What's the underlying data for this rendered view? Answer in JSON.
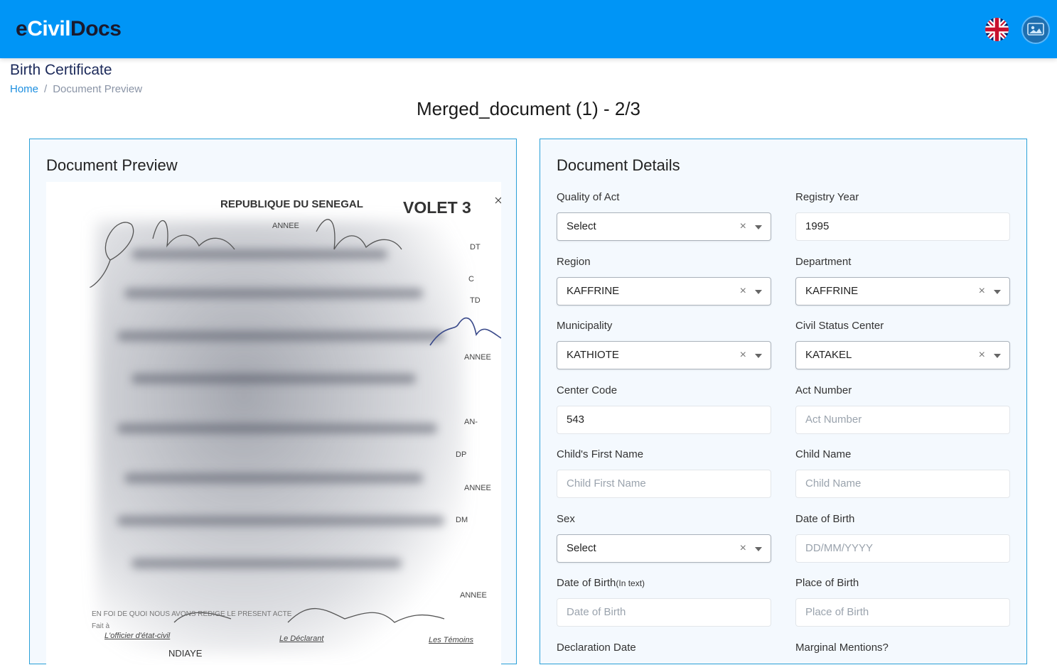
{
  "header": {
    "logo_part1": "e",
    "logo_part2": "Civil",
    "logo_part3": "Docs",
    "language_icon": "uk-flag-icon",
    "avatar_icon": "user-avatar-icon"
  },
  "page": {
    "title": "Birth Certificate",
    "breadcrumb": {
      "home": "Home",
      "separator": "/",
      "current": "Document Preview"
    },
    "document_title": "Merged_document (1) - 2/3"
  },
  "preview": {
    "heading": "Document Preview",
    "doc_header": "REPUBLIQUE DU SENEGAL",
    "volet": "VOLET 3",
    "annee": "ANNEE",
    "boxes": [
      "DT",
      "C",
      "TD",
      "ANNEE",
      "AN-",
      "DP",
      "ANNEE",
      "DM",
      "ANNEE"
    ],
    "footer_line": "EN FOI DE QUOI NOUS AVONS REDIGE LE PRESENT ACTE",
    "fait_a": "Fait à",
    "officier": "L'officier d'état-civil",
    "declarant": "Le Déclarant",
    "temoins": "Les Témoins",
    "signature_name": "NDIAYE"
  },
  "details": {
    "heading": "Document Details",
    "fields": {
      "quality_of_act": {
        "label": "Quality of Act",
        "value": "Select"
      },
      "registry_year": {
        "label": "Registry Year",
        "value": "1995"
      },
      "region": {
        "label": "Region",
        "value": "KAFFRINE"
      },
      "department": {
        "label": "Department",
        "value": "KAFFRINE"
      },
      "municipality": {
        "label": "Municipality",
        "value": "KATHIOTE"
      },
      "civil_status_center": {
        "label": "Civil Status Center",
        "value": "KATAKEL"
      },
      "center_code": {
        "label": "Center Code",
        "value": "543"
      },
      "act_number": {
        "label": "Act Number",
        "placeholder": "Act Number"
      },
      "child_first_name": {
        "label": "Child's First Name",
        "placeholder": "Child First Name"
      },
      "child_name": {
        "label": "Child Name",
        "placeholder": "Child Name"
      },
      "sex": {
        "label": "Sex",
        "value": "Select"
      },
      "date_of_birth": {
        "label": "Date of Birth",
        "placeholder": "DD/MM/YYYY"
      },
      "date_of_birth_text": {
        "label": "Date of Birth",
        "label_suffix": "(In text)",
        "placeholder": "Date of Birth"
      },
      "place_of_birth": {
        "label": "Place of Birth",
        "placeholder": "Place of Birth"
      },
      "declaration_date": {
        "label": "Declaration Date"
      },
      "marginal_mentions": {
        "label": "Marginal Mentions?"
      }
    },
    "clear_symbol": "×"
  },
  "colors": {
    "topbar": "#0095f6",
    "card_border": "#2aa0d8",
    "link": "#1d8fe0"
  }
}
